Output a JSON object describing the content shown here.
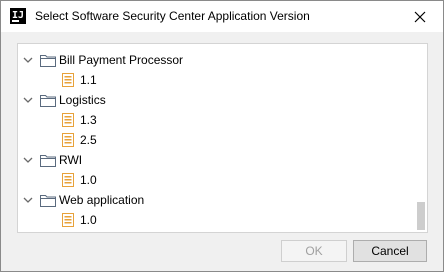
{
  "window": {
    "title": "Select Software Security Center Application Version",
    "app_icon_text": "IJ",
    "icons": {
      "app": "intellij-app-icon",
      "close": "close-icon"
    }
  },
  "tree": {
    "icons": {
      "expand": "chevron-down-icon",
      "group": "folder-icon",
      "item": "document-icon"
    },
    "colors": {
      "folder": "#5a6a7e",
      "document": "#e8a23a"
    },
    "nodes": [
      {
        "label": "Bill Payment Processor",
        "versions": [
          "1.1"
        ]
      },
      {
        "label": "Logistics",
        "versions": [
          "1.3",
          "2.5"
        ]
      },
      {
        "label": "RWI",
        "versions": [
          "1.0"
        ]
      },
      {
        "label": "Web application",
        "versions": [
          "1.0"
        ]
      }
    ]
  },
  "buttons": {
    "ok_label": "OK",
    "ok_enabled": false,
    "cancel_label": "Cancel"
  }
}
